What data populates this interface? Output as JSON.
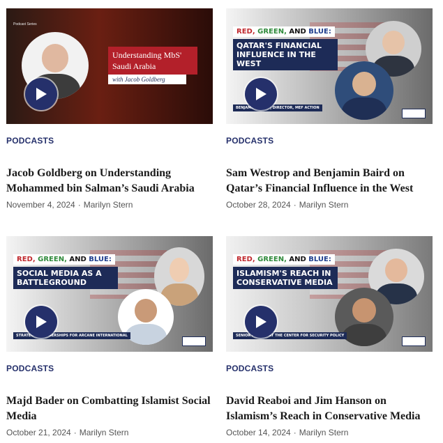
{
  "cards": [
    {
      "category": "PODCASTS",
      "title": "Jacob Goldberg on Understanding Mohammed bin Salman’s Saudi Arabia",
      "date": "November 4, 2024",
      "author": "Marilyn Stern",
      "thumb": {
        "series_label": "Podcast Series",
        "headline": "Understanding MbS' Saudi Arabia",
        "subline": "with Jacob Goldberg"
      }
    },
    {
      "category": "PODCASTS",
      "title": "Sam Westrop and Benjamin Baird on Qatar’s Financial Influence in the West",
      "date": "October 28, 2024",
      "author": "Marilyn Stern",
      "thumb": {
        "banner_red": "RED,",
        "banner_green": "GREEN,",
        "banner_and": "AND",
        "banner_blue": "BLUE:",
        "headline": "QATAR'S FINANCIAL INFLUENCE IN THE WEST",
        "caption": "BENJAMIN BAIRD | DIRECTOR, MEF ACTION"
      }
    },
    {
      "category": "PODCASTS",
      "title": "Majd Bader on Combatting Islamist Social Media",
      "date": "October 21, 2024",
      "author": "Marilyn Stern",
      "thumb": {
        "banner_red": "RED,",
        "banner_green": "GREEN,",
        "banner_and": "AND",
        "banner_blue": "BLUE:",
        "headline": "SOCIAL MEDIA AS A BATTLEGROUND",
        "caption": "STRATEGIC PARTNERSHIPS FOR ARCANE INTERNATIONAL"
      }
    },
    {
      "category": "PODCASTS",
      "title": "David Reaboi and Jim Hanson on Islamism’s Reach in Conservative Media",
      "date": "October 14, 2024",
      "author": "Marilyn Stern",
      "thumb": {
        "banner_red": "RED,",
        "banner_green": "GREEN,",
        "banner_and": "AND",
        "banner_blue": "BLUE:",
        "headline": "ISLAMISM'S REACH IN CONSERVATIVE MEDIA",
        "caption": "SENIOR FELLOW AT THE CENTER FOR SECURITY POLICY"
      }
    }
  ],
  "colors": {
    "accent_navy": "#25306b",
    "brand_red": "#b3202a"
  },
  "icons": {
    "play": "play-icon"
  }
}
